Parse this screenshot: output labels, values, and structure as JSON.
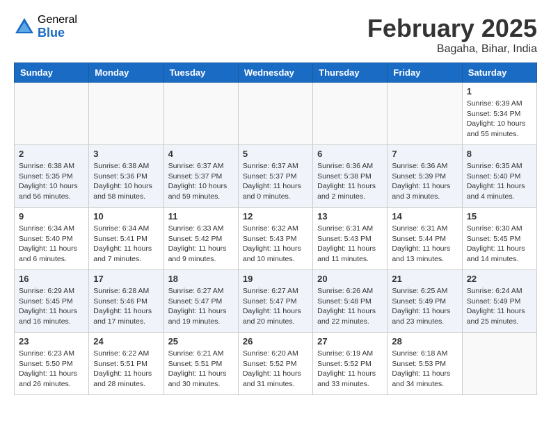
{
  "header": {
    "logo_general": "General",
    "logo_blue": "Blue",
    "month_title": "February 2025",
    "location": "Bagaha, Bihar, India"
  },
  "weekdays": [
    "Sunday",
    "Monday",
    "Tuesday",
    "Wednesday",
    "Thursday",
    "Friday",
    "Saturday"
  ],
  "weeks": [
    [
      {
        "day": "",
        "info": ""
      },
      {
        "day": "",
        "info": ""
      },
      {
        "day": "",
        "info": ""
      },
      {
        "day": "",
        "info": ""
      },
      {
        "day": "",
        "info": ""
      },
      {
        "day": "",
        "info": ""
      },
      {
        "day": "1",
        "info": "Sunrise: 6:39 AM\nSunset: 5:34 PM\nDaylight: 10 hours\nand 55 minutes."
      }
    ],
    [
      {
        "day": "2",
        "info": "Sunrise: 6:38 AM\nSunset: 5:35 PM\nDaylight: 10 hours\nand 56 minutes."
      },
      {
        "day": "3",
        "info": "Sunrise: 6:38 AM\nSunset: 5:36 PM\nDaylight: 10 hours\nand 58 minutes."
      },
      {
        "day": "4",
        "info": "Sunrise: 6:37 AM\nSunset: 5:37 PM\nDaylight: 10 hours\nand 59 minutes."
      },
      {
        "day": "5",
        "info": "Sunrise: 6:37 AM\nSunset: 5:37 PM\nDaylight: 11 hours\nand 0 minutes."
      },
      {
        "day": "6",
        "info": "Sunrise: 6:36 AM\nSunset: 5:38 PM\nDaylight: 11 hours\nand 2 minutes."
      },
      {
        "day": "7",
        "info": "Sunrise: 6:36 AM\nSunset: 5:39 PM\nDaylight: 11 hours\nand 3 minutes."
      },
      {
        "day": "8",
        "info": "Sunrise: 6:35 AM\nSunset: 5:40 PM\nDaylight: 11 hours\nand 4 minutes."
      }
    ],
    [
      {
        "day": "9",
        "info": "Sunrise: 6:34 AM\nSunset: 5:40 PM\nDaylight: 11 hours\nand 6 minutes."
      },
      {
        "day": "10",
        "info": "Sunrise: 6:34 AM\nSunset: 5:41 PM\nDaylight: 11 hours\nand 7 minutes."
      },
      {
        "day": "11",
        "info": "Sunrise: 6:33 AM\nSunset: 5:42 PM\nDaylight: 11 hours\nand 9 minutes."
      },
      {
        "day": "12",
        "info": "Sunrise: 6:32 AM\nSunset: 5:43 PM\nDaylight: 11 hours\nand 10 minutes."
      },
      {
        "day": "13",
        "info": "Sunrise: 6:31 AM\nSunset: 5:43 PM\nDaylight: 11 hours\nand 11 minutes."
      },
      {
        "day": "14",
        "info": "Sunrise: 6:31 AM\nSunset: 5:44 PM\nDaylight: 11 hours\nand 13 minutes."
      },
      {
        "day": "15",
        "info": "Sunrise: 6:30 AM\nSunset: 5:45 PM\nDaylight: 11 hours\nand 14 minutes."
      }
    ],
    [
      {
        "day": "16",
        "info": "Sunrise: 6:29 AM\nSunset: 5:45 PM\nDaylight: 11 hours\nand 16 minutes."
      },
      {
        "day": "17",
        "info": "Sunrise: 6:28 AM\nSunset: 5:46 PM\nDaylight: 11 hours\nand 17 minutes."
      },
      {
        "day": "18",
        "info": "Sunrise: 6:27 AM\nSunset: 5:47 PM\nDaylight: 11 hours\nand 19 minutes."
      },
      {
        "day": "19",
        "info": "Sunrise: 6:27 AM\nSunset: 5:47 PM\nDaylight: 11 hours\nand 20 minutes."
      },
      {
        "day": "20",
        "info": "Sunrise: 6:26 AM\nSunset: 5:48 PM\nDaylight: 11 hours\nand 22 minutes."
      },
      {
        "day": "21",
        "info": "Sunrise: 6:25 AM\nSunset: 5:49 PM\nDaylight: 11 hours\nand 23 minutes."
      },
      {
        "day": "22",
        "info": "Sunrise: 6:24 AM\nSunset: 5:49 PM\nDaylight: 11 hours\nand 25 minutes."
      }
    ],
    [
      {
        "day": "23",
        "info": "Sunrise: 6:23 AM\nSunset: 5:50 PM\nDaylight: 11 hours\nand 26 minutes."
      },
      {
        "day": "24",
        "info": "Sunrise: 6:22 AM\nSunset: 5:51 PM\nDaylight: 11 hours\nand 28 minutes."
      },
      {
        "day": "25",
        "info": "Sunrise: 6:21 AM\nSunset: 5:51 PM\nDaylight: 11 hours\nand 30 minutes."
      },
      {
        "day": "26",
        "info": "Sunrise: 6:20 AM\nSunset: 5:52 PM\nDaylight: 11 hours\nand 31 minutes."
      },
      {
        "day": "27",
        "info": "Sunrise: 6:19 AM\nSunset: 5:52 PM\nDaylight: 11 hours\nand 33 minutes."
      },
      {
        "day": "28",
        "info": "Sunrise: 6:18 AM\nSunset: 5:53 PM\nDaylight: 11 hours\nand 34 minutes."
      },
      {
        "day": "",
        "info": ""
      }
    ]
  ]
}
